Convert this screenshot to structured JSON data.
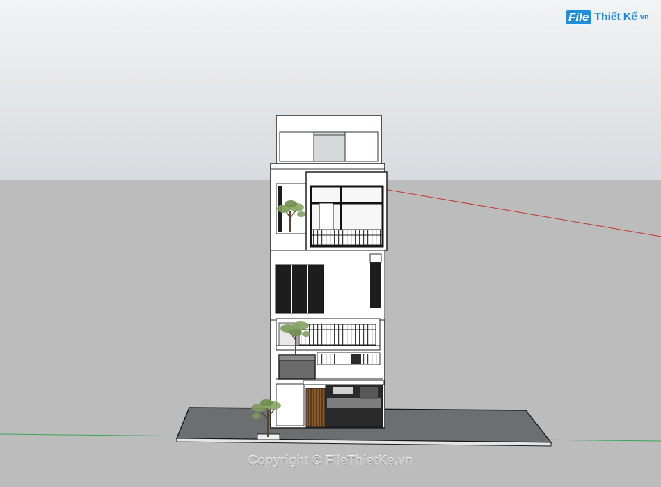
{
  "watermark": {
    "logo_file": "File",
    "logo_rest": "Thiết Kế",
    "logo_tld": ".vn",
    "copyright": "Copyright © FileThietKe.vn"
  },
  "scene": {
    "sky_color": "#d9dee3",
    "ground_color": "#b9b9b9",
    "sidewalk_color": "#6f7173",
    "red_axis_color": "#c0392b",
    "green_axis_color": "#3aa655"
  }
}
